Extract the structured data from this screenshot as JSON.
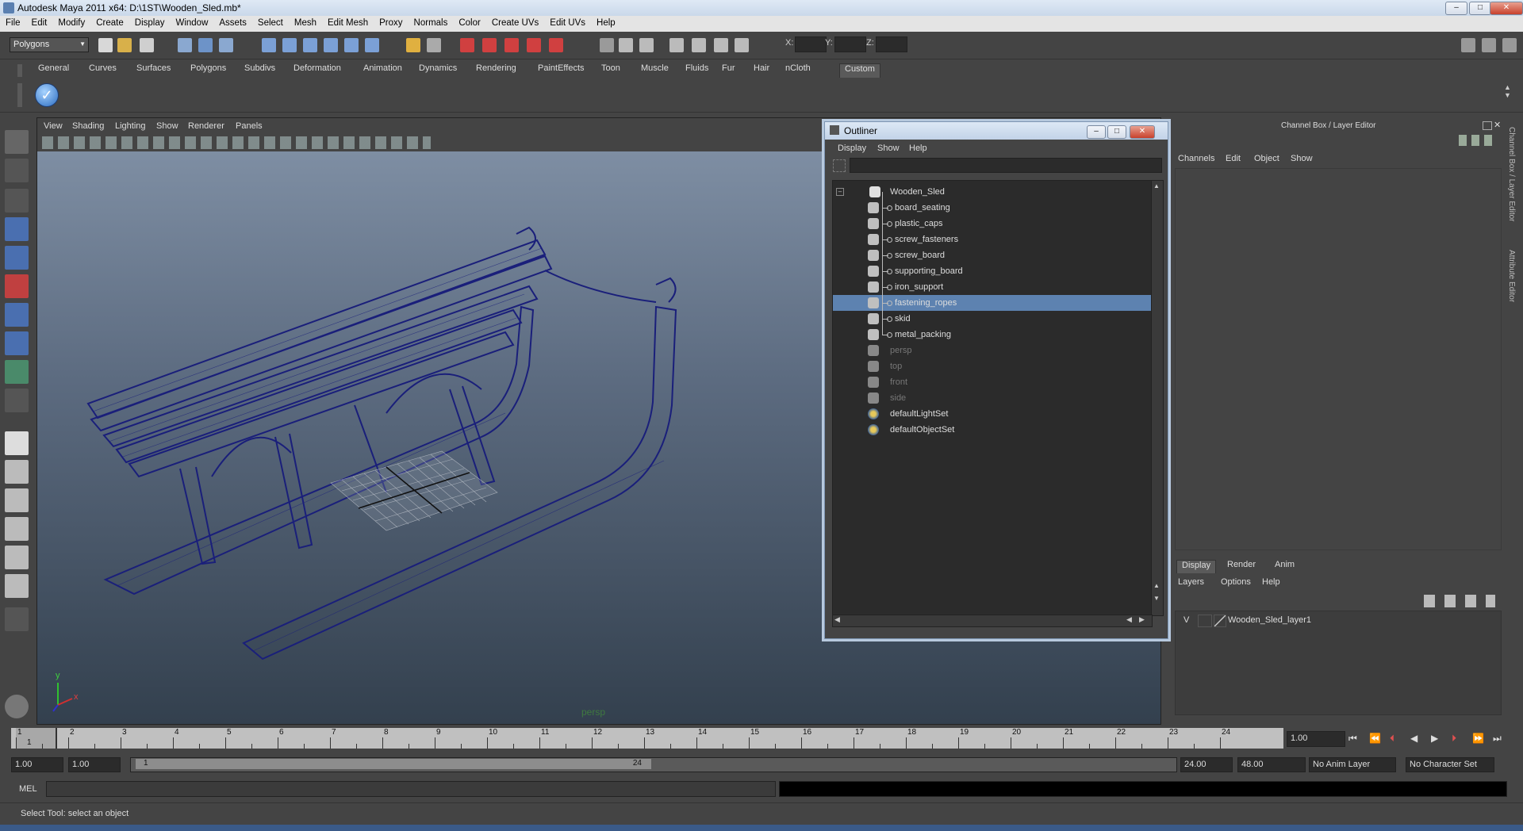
{
  "window": {
    "title": "Autodesk Maya 2011 x64: D:\\1ST\\Wooden_Sled.mb*"
  },
  "menubar": [
    "File",
    "Edit",
    "Modify",
    "Create",
    "Display",
    "Window",
    "Assets",
    "Select",
    "Mesh",
    "Edit Mesh",
    "Proxy",
    "Normals",
    "Color",
    "Create UVs",
    "Edit UVs",
    "Help"
  ],
  "statusline": {
    "mode": "Polygons",
    "x_label": "X:",
    "y_label": "Y:",
    "z_label": "Z:"
  },
  "shelf_tabs": [
    "General",
    "Curves",
    "Surfaces",
    "Polygons",
    "Subdivs",
    "Deformation",
    "Animation",
    "Dynamics",
    "Rendering",
    "PaintEffects",
    "Toon",
    "Muscle",
    "Fluids",
    "Fur",
    "Hair",
    "nCloth",
    "Custom"
  ],
  "shelf_active": "Custom",
  "viewport": {
    "menu": [
      "View",
      "Shading",
      "Lighting",
      "Show",
      "Renderer",
      "Panels"
    ],
    "camera_label": "persp",
    "axis_y": "y",
    "axis_x": "x"
  },
  "outliner": {
    "title": "Outliner",
    "menu": [
      "Display",
      "Show",
      "Help"
    ],
    "items": [
      {
        "label": "Wooden_Sled",
        "level": 0,
        "type": "group",
        "selected": false,
        "dim": false
      },
      {
        "label": "board_seating",
        "level": 1,
        "type": "mesh",
        "selected": false,
        "dim": false
      },
      {
        "label": "plastic_caps",
        "level": 1,
        "type": "mesh",
        "selected": false,
        "dim": false
      },
      {
        "label": "screw_fasteners",
        "level": 1,
        "type": "mesh",
        "selected": false,
        "dim": false
      },
      {
        "label": "screw_board",
        "level": 1,
        "type": "mesh",
        "selected": false,
        "dim": false
      },
      {
        "label": "supporting_board",
        "level": 1,
        "type": "mesh",
        "selected": false,
        "dim": false
      },
      {
        "label": "iron_support",
        "level": 1,
        "type": "mesh",
        "selected": false,
        "dim": false
      },
      {
        "label": "fastening_ropes",
        "level": 1,
        "type": "mesh",
        "selected": true,
        "dim": false
      },
      {
        "label": "skid",
        "level": 1,
        "type": "mesh",
        "selected": false,
        "dim": false
      },
      {
        "label": "metal_packing",
        "level": 1,
        "type": "mesh",
        "selected": false,
        "dim": false
      },
      {
        "label": "persp",
        "level": 0,
        "type": "camera",
        "selected": false,
        "dim": true
      },
      {
        "label": "top",
        "level": 0,
        "type": "camera",
        "selected": false,
        "dim": true
      },
      {
        "label": "front",
        "level": 0,
        "type": "camera",
        "selected": false,
        "dim": true
      },
      {
        "label": "side",
        "level": 0,
        "type": "camera",
        "selected": false,
        "dim": true
      },
      {
        "label": "defaultLightSet",
        "level": 0,
        "type": "set",
        "selected": false,
        "dim": false
      },
      {
        "label": "defaultObjectSet",
        "level": 0,
        "type": "set",
        "selected": false,
        "dim": false
      }
    ]
  },
  "channel_box": {
    "title": "Channel Box / Layer Editor",
    "menu": [
      "Channels",
      "Edit",
      "Object",
      "Show"
    ],
    "layer_tabs": [
      "Display",
      "Render",
      "Anim"
    ],
    "layer_tab_active": "Display",
    "layer_menu": [
      "Layers",
      "Options",
      "Help"
    ],
    "layers": [
      {
        "visible": "V",
        "name": "Wooden_Sled_layer1"
      }
    ]
  },
  "side_tabs": [
    "Channel Box / Layer Editor",
    "Attribute Editor"
  ],
  "timeline": {
    "ticks": [
      "1",
      "2",
      "3",
      "4",
      "5",
      "6",
      "7",
      "8",
      "9",
      "10",
      "11",
      "12",
      "13",
      "14",
      "15",
      "16",
      "17",
      "18",
      "19",
      "20",
      "21",
      "22",
      "23",
      "24"
    ],
    "current_marker": "1",
    "current_frame": "1.00"
  },
  "range": {
    "start": "1.00",
    "playback_start": "1.00",
    "handle_start": "1",
    "handle_end": "24",
    "playback_end": "24.00",
    "end": "48.00",
    "anim_layer": "No Anim Layer",
    "character_set": "No Character Set"
  },
  "command": {
    "label": "MEL"
  },
  "help_line": "Select Tool: select an object",
  "colors": {
    "wireframe": "#1a1f7a",
    "selection": "#5d82b0",
    "viewport_top": "#7e8ea3",
    "viewport_bottom": "#33404e"
  }
}
